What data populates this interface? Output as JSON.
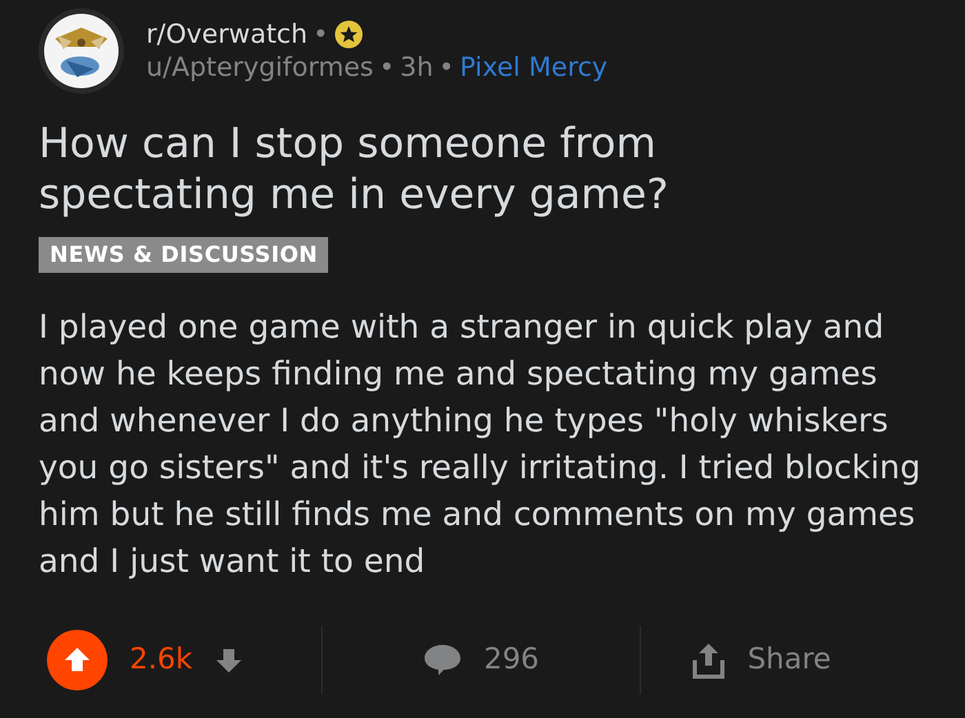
{
  "post_header": {
    "subreddit": "r/Overwatch",
    "separator_1": "•",
    "author": "u/Apterygiformes",
    "separator_2": "•",
    "time": "3h",
    "separator_3": "•",
    "user_flair": "Pixel Mercy"
  },
  "title": "How can I stop someone from spectating me in every game?",
  "post_flair": "NEWS & DISCUSSION",
  "body": "I played one game with a stranger in quick play and now he keeps finding me and spectating my games and whenever I do anything he types \"holy whiskers you go sisters\" and it's really irritating. I tried blocking him but he still finds me and comments on my games and I just want it to end",
  "actions": {
    "upvoted": true,
    "score": "2.6k",
    "comments": "296",
    "share": "Share"
  }
}
